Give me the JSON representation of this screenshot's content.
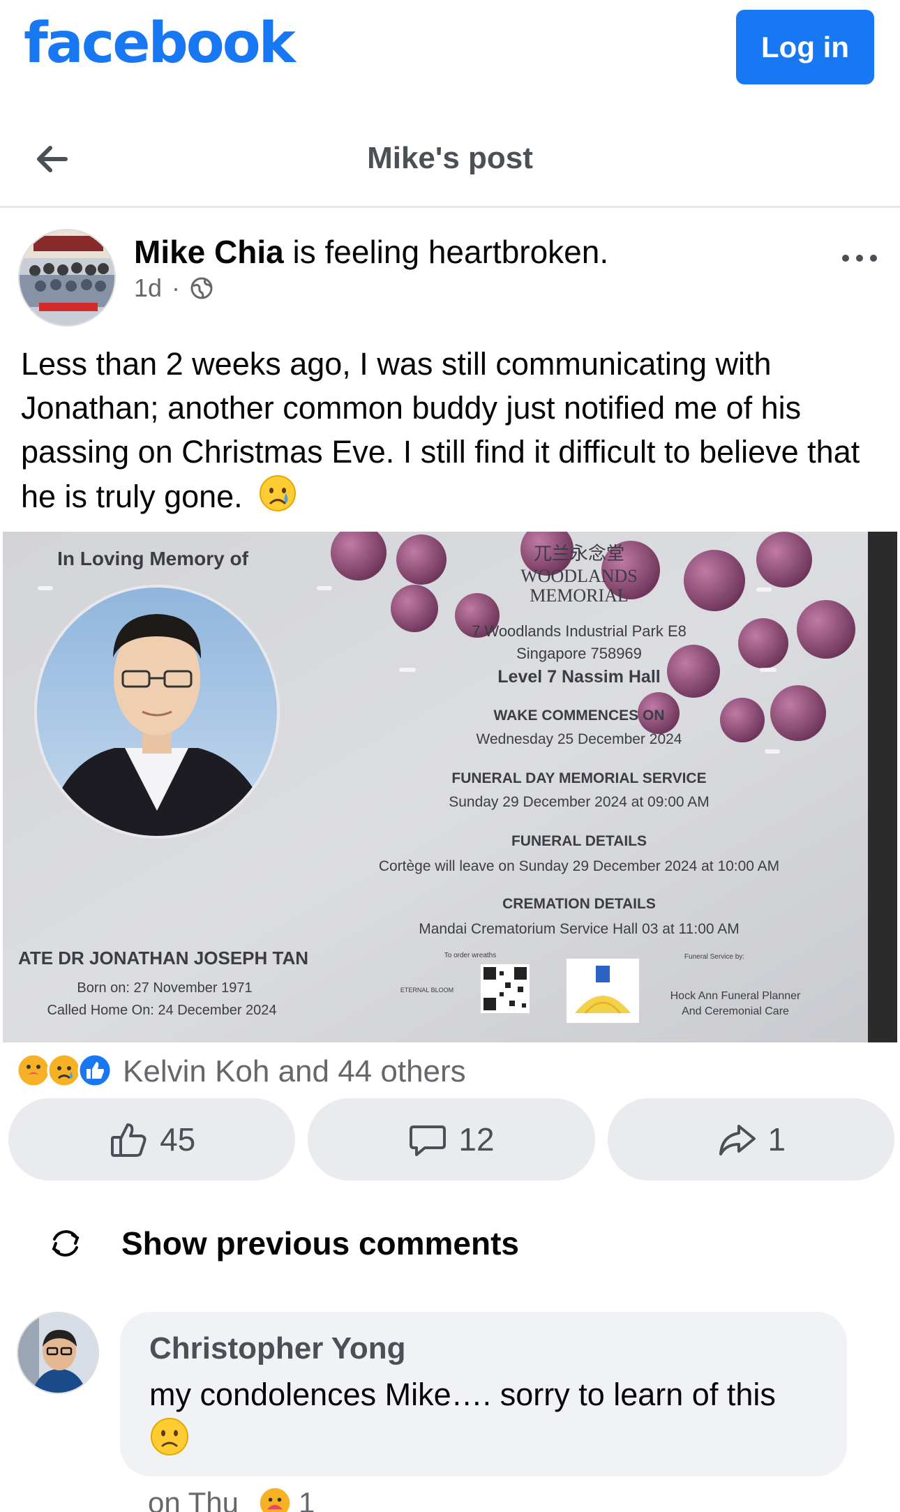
{
  "header": {
    "logo": "facebook",
    "login_label": "Log in"
  },
  "nav": {
    "title": "Mike's post"
  },
  "post": {
    "author": "Mike Chia",
    "feeling": " is feeling heartbroken.",
    "time": "1d",
    "separator": "·",
    "text": "Less than 2 weeks ago, I was still communicating with Jonathan; another common buddy just notified me of his passing on Christmas Eve. I still find it difficult to believe that he is truly gone.",
    "text_emoji": "crying-face-emoji"
  },
  "image": {
    "in_memory": "In Loving Memory of",
    "chinese": "兀兰永念堂",
    "venue1": "WOODLANDS",
    "venue2": "MEMORIAL",
    "address1": "7 Woodlands Industrial Park E8",
    "address2": "Singapore 758969",
    "hall": "Level 7 Nassim Hall",
    "wake_h": "WAKE COMMENCES ON",
    "wake_v": "Wednesday 25 December 2024",
    "funeral_h": "FUNERAL DAY MEMORIAL SERVICE",
    "funeral_v": "Sunday 29 December 2024 at 09:00 AM",
    "details_h": "FUNERAL DETAILS",
    "details_v": "Cortège will leave on Sunday 29 December 2024 at 10:00 AM",
    "cremation_h": "CREMATION DETAILS",
    "cremation_v": "Mandai Crematorium Service Hall 03 at 11:00 AM",
    "deceased": "ATE DR JONATHAN JOSEPH TAN",
    "born": "Born on: 27 November 1971",
    "called": "Called Home On: 24 December 2024",
    "wreaths": "To order wreaths",
    "eternal": "ETERNAL BLOOM",
    "service_by": "Funeral Service by:",
    "planner1": "Hock Ann Funeral Planner",
    "planner2": "And Ceremonial Care"
  },
  "reactions": {
    "summary": "Kelvin Koh and 44 others",
    "icons": [
      "care-reaction-icon",
      "sad-reaction-icon",
      "like-reaction-icon"
    ]
  },
  "actions": {
    "likes": "45",
    "comments": "12",
    "shares": "1"
  },
  "comments": {
    "show_previous": "Show previous comments",
    "items": [
      {
        "author": "Christopher Yong",
        "text": "my condolences Mike…. sorry to learn of this",
        "time": "on Thu",
        "reaction_count": "1"
      }
    ]
  },
  "colors": {
    "brand": "#1877f2",
    "muted": "#65676b",
    "bubble": "#f0f2f5",
    "button": "#e9ebee"
  }
}
